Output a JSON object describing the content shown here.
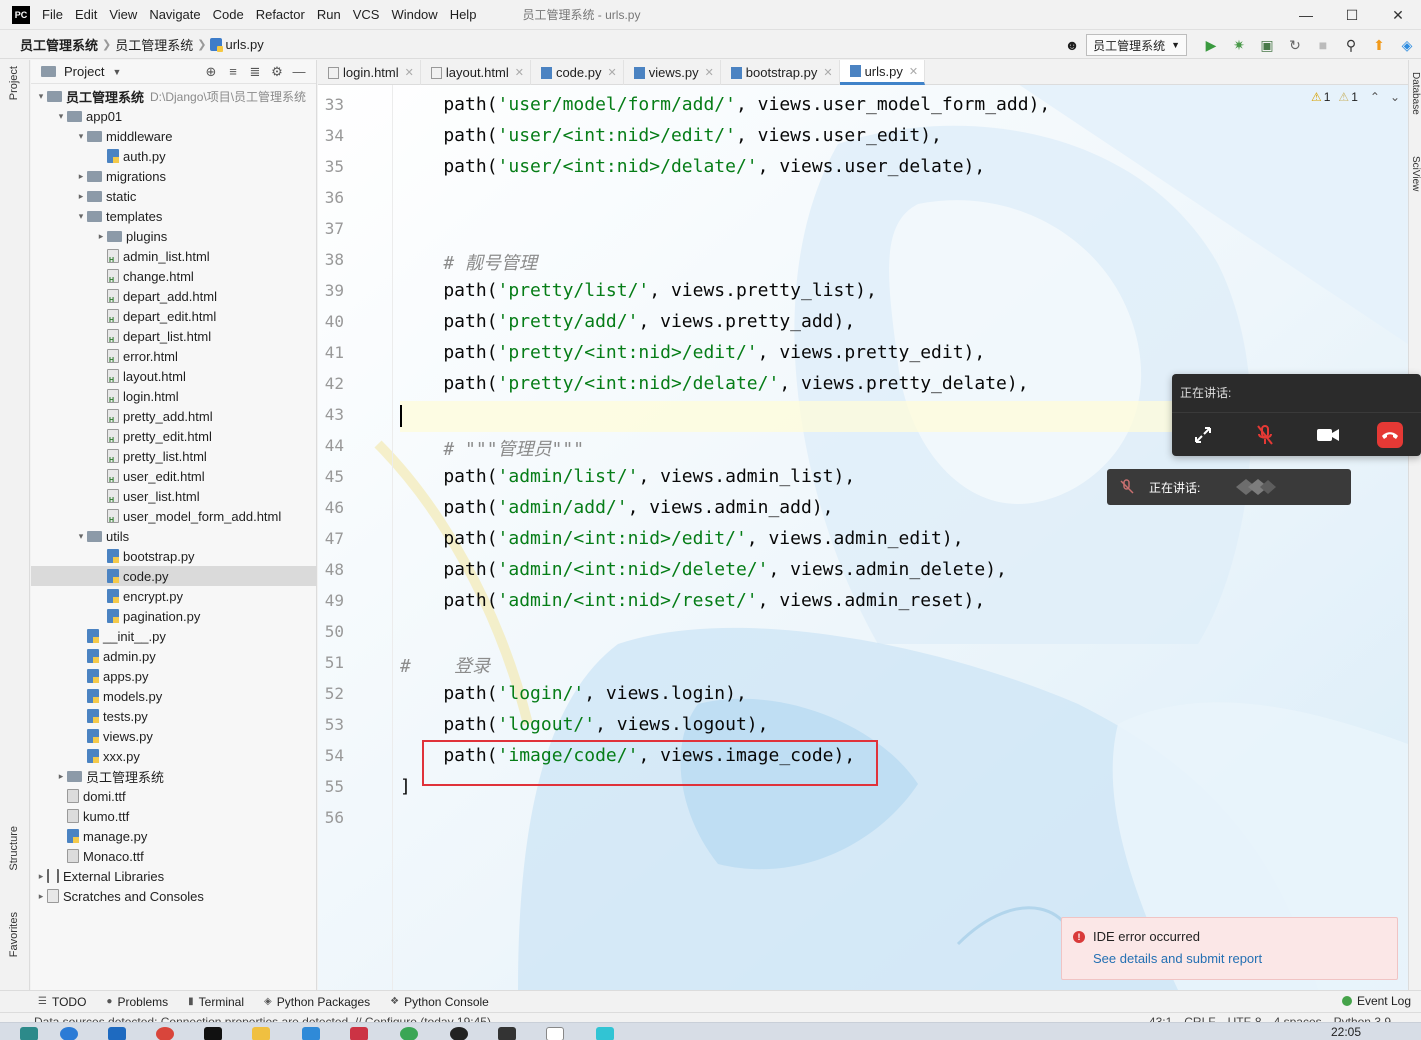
{
  "titlebar": {
    "menus": [
      "File",
      "Edit",
      "View",
      "Navigate",
      "Code",
      "Refactor",
      "Run",
      "VCS",
      "Window",
      "Help"
    ],
    "window_title": "员工管理系统 - urls.py",
    "logo": "PC"
  },
  "breadcrumb": [
    "员工管理系统",
    "员工管理系统",
    "urls.py"
  ],
  "run_config": "员工管理系统",
  "project_panel": {
    "title": "Project",
    "tree": [
      {
        "label": "员工管理系统",
        "sub": "D:\\Django\\项目\\员工管理系统",
        "kind": "folder",
        "level": 0,
        "arrow": "down"
      },
      {
        "label": "app01",
        "kind": "folder",
        "level": 1,
        "arrow": "down"
      },
      {
        "label": "middleware",
        "kind": "folder",
        "level": 2,
        "arrow": "down"
      },
      {
        "label": "auth.py",
        "kind": "py",
        "level": 3
      },
      {
        "label": "migrations",
        "kind": "folder",
        "level": 2,
        "arrow": "right"
      },
      {
        "label": "static",
        "kind": "folder",
        "level": 2,
        "arrow": "right"
      },
      {
        "label": "templates",
        "kind": "folder",
        "level": 2,
        "arrow": "down"
      },
      {
        "label": "plugins",
        "kind": "folder",
        "level": 3,
        "arrow": "right"
      },
      {
        "label": "admin_list.html",
        "kind": "html",
        "level": 3
      },
      {
        "label": "change.html",
        "kind": "html",
        "level": 3
      },
      {
        "label": "depart_add.html",
        "kind": "html",
        "level": 3
      },
      {
        "label": "depart_edit.html",
        "kind": "html",
        "level": 3
      },
      {
        "label": "depart_list.html",
        "kind": "html",
        "level": 3
      },
      {
        "label": "error.html",
        "kind": "html",
        "level": 3
      },
      {
        "label": "layout.html",
        "kind": "html",
        "level": 3
      },
      {
        "label": "login.html",
        "kind": "html",
        "level": 3
      },
      {
        "label": "pretty_add.html",
        "kind": "html",
        "level": 3
      },
      {
        "label": "pretty_edit.html",
        "kind": "html",
        "level": 3
      },
      {
        "label": "pretty_list.html",
        "kind": "html",
        "level": 3
      },
      {
        "label": "user_edit.html",
        "kind": "html",
        "level": 3
      },
      {
        "label": "user_list.html",
        "kind": "html",
        "level": 3
      },
      {
        "label": "user_model_form_add.html",
        "kind": "html",
        "level": 3
      },
      {
        "label": "utils",
        "kind": "folder",
        "level": 2,
        "arrow": "down"
      },
      {
        "label": "bootstrap.py",
        "kind": "py",
        "level": 3
      },
      {
        "label": "code.py",
        "kind": "py",
        "level": 3,
        "selected": true
      },
      {
        "label": "encrypt.py",
        "kind": "py",
        "level": 3
      },
      {
        "label": "pagination.py",
        "kind": "py",
        "level": 3
      },
      {
        "label": "__init__.py",
        "kind": "py",
        "level": 2
      },
      {
        "label": "admin.py",
        "kind": "py",
        "level": 2
      },
      {
        "label": "apps.py",
        "kind": "py",
        "level": 2
      },
      {
        "label": "models.py",
        "kind": "py",
        "level": 2
      },
      {
        "label": "tests.py",
        "kind": "py",
        "level": 2
      },
      {
        "label": "views.py",
        "kind": "py",
        "level": 2
      },
      {
        "label": "xxx.py",
        "kind": "py",
        "level": 2
      },
      {
        "label": "员工管理系统",
        "kind": "folder",
        "level": 1,
        "arrow": "right"
      },
      {
        "label": "domi.ttf",
        "kind": "ttf",
        "level": 1
      },
      {
        "label": "kumo.ttf",
        "kind": "ttf",
        "level": 1
      },
      {
        "label": "manage.py",
        "kind": "py",
        "level": 1
      },
      {
        "label": "Monaco.ttf",
        "kind": "ttf",
        "level": 1
      },
      {
        "label": "External Libraries",
        "kind": "lib",
        "level": 0,
        "arrow": "right"
      },
      {
        "label": "Scratches and Consoles",
        "kind": "scratch",
        "level": 0,
        "arrow": "right"
      }
    ]
  },
  "editor": {
    "tabs": [
      {
        "label": "login.html",
        "kind": "html"
      },
      {
        "label": "layout.html",
        "kind": "html"
      },
      {
        "label": "code.py",
        "kind": "py"
      },
      {
        "label": "views.py",
        "kind": "py"
      },
      {
        "label": "bootstrap.py",
        "kind": "py"
      },
      {
        "label": "urls.py",
        "kind": "py",
        "active": true
      }
    ],
    "inspections": {
      "warnings": "1",
      "weak_warnings": "1"
    },
    "current_line": 43,
    "highlighted_line": 54,
    "lines": [
      {
        "n": "33",
        "parts": [
          [
            "",
            "    path("
          ],
          [
            "str",
            "'user/model/form/add/'"
          ],
          [
            "",
            ", views.user_model_form_add),"
          ]
        ]
      },
      {
        "n": "34",
        "parts": [
          [
            "",
            "    path("
          ],
          [
            "str",
            "'user/<int:nid>/edit/'"
          ],
          [
            "",
            ", views.user_edit),"
          ]
        ]
      },
      {
        "n": "35",
        "parts": [
          [
            "",
            "    path("
          ],
          [
            "str",
            "'user/<int:nid>/delate/'"
          ],
          [
            "",
            ", views.user_delate),"
          ]
        ]
      },
      {
        "n": "36",
        "parts": []
      },
      {
        "n": "37",
        "parts": []
      },
      {
        "n": "38",
        "parts": [
          [
            "",
            "    "
          ],
          [
            "cmt",
            "# 靓号管理"
          ]
        ]
      },
      {
        "n": "39",
        "parts": [
          [
            "",
            "    path("
          ],
          [
            "str",
            "'pretty/list/'"
          ],
          [
            "",
            ", views.pretty_list),"
          ]
        ]
      },
      {
        "n": "40",
        "parts": [
          [
            "",
            "    path("
          ],
          [
            "str",
            "'pretty/add/'"
          ],
          [
            "",
            ", views.pretty_add),"
          ]
        ]
      },
      {
        "n": "41",
        "parts": [
          [
            "",
            "    path("
          ],
          [
            "str",
            "'pretty/<int:nid>/edit/'"
          ],
          [
            "",
            ", views.pretty_edit),"
          ]
        ]
      },
      {
        "n": "42",
        "parts": [
          [
            "",
            "    path("
          ],
          [
            "str",
            "'pretty/<int:nid>/delate/'"
          ],
          [
            "",
            ", views.pretty_delate),"
          ]
        ]
      },
      {
        "n": "43",
        "parts": []
      },
      {
        "n": "44",
        "parts": [
          [
            "",
            "    "
          ],
          [
            "cmt",
            "# \"\"\"管理员\"\"\""
          ]
        ]
      },
      {
        "n": "45",
        "parts": [
          [
            "",
            "    path("
          ],
          [
            "str",
            "'admin/list/'"
          ],
          [
            "",
            ", views.admin_list),"
          ]
        ]
      },
      {
        "n": "46",
        "parts": [
          [
            "",
            "    path("
          ],
          [
            "str",
            "'admin/add/'"
          ],
          [
            "",
            ", views.admin_add),"
          ]
        ]
      },
      {
        "n": "47",
        "parts": [
          [
            "",
            "    path("
          ],
          [
            "str",
            "'admin/<int:nid>/edit/'"
          ],
          [
            "",
            ", views.admin_edit),"
          ]
        ]
      },
      {
        "n": "48",
        "parts": [
          [
            "",
            "    path("
          ],
          [
            "str",
            "'admin/<int:nid>/delete/'"
          ],
          [
            "",
            ", views.admin_delete),"
          ]
        ]
      },
      {
        "n": "49",
        "parts": [
          [
            "",
            "    path("
          ],
          [
            "str",
            "'admin/<int:nid>/reset/'"
          ],
          [
            "",
            ", views.admin_reset),"
          ]
        ]
      },
      {
        "n": "50",
        "parts": []
      },
      {
        "n": "51",
        "parts": [
          [
            "cmt",
            "#    登录"
          ]
        ]
      },
      {
        "n": "52",
        "parts": [
          [
            "",
            "    path("
          ],
          [
            "str",
            "'login/'"
          ],
          [
            "",
            ", views.login),"
          ]
        ]
      },
      {
        "n": "53",
        "parts": [
          [
            "",
            "    path("
          ],
          [
            "str",
            "'logout/'"
          ],
          [
            "",
            ", views.logout),"
          ]
        ]
      },
      {
        "n": "54",
        "parts": [
          [
            "",
            "    path("
          ],
          [
            "str",
            "'image/code/'"
          ],
          [
            "",
            ", views.image_code),"
          ]
        ]
      },
      {
        "n": "55",
        "parts": [
          [
            "",
            "]"
          ]
        ]
      },
      {
        "n": "56",
        "parts": []
      }
    ]
  },
  "right_stripe": [
    "Database",
    "SciView"
  ],
  "left_stripe": [
    "Project",
    "Structure",
    "Favorites"
  ],
  "call_panel": {
    "title": "正在讲话:"
  },
  "speaking_bar": {
    "text": "正在讲话:"
  },
  "error_toast": {
    "title": "IDE error occurred",
    "link": "See details and submit report"
  },
  "tool_windows": [
    "TODO",
    "Problems",
    "Terminal",
    "Python Packages",
    "Python Console"
  ],
  "event_log": "Event Log",
  "status": {
    "message": "Data sources detected: Connection properties are detected. // Configure (today 19:45)",
    "position": "43:1",
    "line_sep": "CRLF",
    "encoding": "UTF-8",
    "indent": "4 spaces",
    "interpreter": "Python 3.9"
  },
  "clock": "22:05",
  "colors": {
    "accent": "#4083c9",
    "string": "#067d17",
    "comment": "#8c8c8c",
    "highlight_box": "#e0323a",
    "error": "#d93a3a"
  }
}
